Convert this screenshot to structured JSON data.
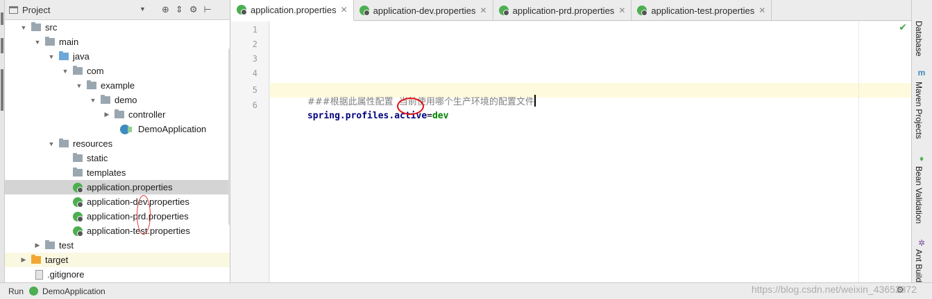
{
  "project_panel": {
    "title": "Project",
    "tree": [
      {
        "label": "src",
        "icon": "folder-icon",
        "expanded": true
      },
      {
        "label": "main",
        "icon": "folder-icon",
        "expanded": true
      },
      {
        "label": "java",
        "icon": "source-folder-icon",
        "expanded": true
      },
      {
        "label": "com",
        "icon": "package-icon",
        "expanded": true
      },
      {
        "label": "example",
        "icon": "package-icon",
        "expanded": true
      },
      {
        "label": "demo",
        "icon": "package-icon",
        "expanded": true
      },
      {
        "label": "controller",
        "icon": "package-icon",
        "expanded": false
      },
      {
        "label": "DemoApplication",
        "icon": "spring-boot-class-icon"
      },
      {
        "label": "resources",
        "icon": "resources-folder-icon",
        "expanded": true
      },
      {
        "label": "static",
        "icon": "folder-icon"
      },
      {
        "label": "templates",
        "icon": "folder-icon"
      },
      {
        "label": "application.properties",
        "icon": "spring-properties-icon",
        "selected": true
      },
      {
        "label": "application-dev.properties",
        "icon": "spring-properties-icon"
      },
      {
        "label": "application-prd.properties",
        "icon": "spring-properties-icon"
      },
      {
        "label": "application-test.properties",
        "icon": "spring-properties-icon"
      },
      {
        "label": "test",
        "icon": "folder-icon",
        "expanded": false
      },
      {
        "label": "target",
        "icon": "excluded-folder-icon",
        "expanded": false
      },
      {
        "label": ".gitignore",
        "icon": "file-icon"
      }
    ]
  },
  "tabs": [
    {
      "label": "application.properties",
      "active": true
    },
    {
      "label": "application-dev.properties"
    },
    {
      "label": "application-prd.properties"
    },
    {
      "label": "application-test.properties"
    }
  ],
  "editor": {
    "line_numbers": [
      "1",
      "2",
      "3",
      "4",
      "5",
      "6"
    ],
    "comment": "###根据此属性配置  当前使用哪个生产环境的配置文件",
    "key": "spring.profiles.active",
    "equals": "=",
    "value": "dev"
  },
  "right_tools": {
    "database": "Database",
    "maven": "Maven Projects",
    "bean": "Bean Validation",
    "ant": "Ant Build"
  },
  "bottom": {
    "run_label": "Run",
    "app_label": "DemoApplication"
  },
  "watermark": "https://blog.csdn.net/weixin_43652872",
  "colors": {
    "selected_row": "#d4d4d4",
    "spring_green": "#4caf50",
    "key_color": "#000080",
    "value_color": "#008000",
    "annotation_red": "#e01010"
  }
}
